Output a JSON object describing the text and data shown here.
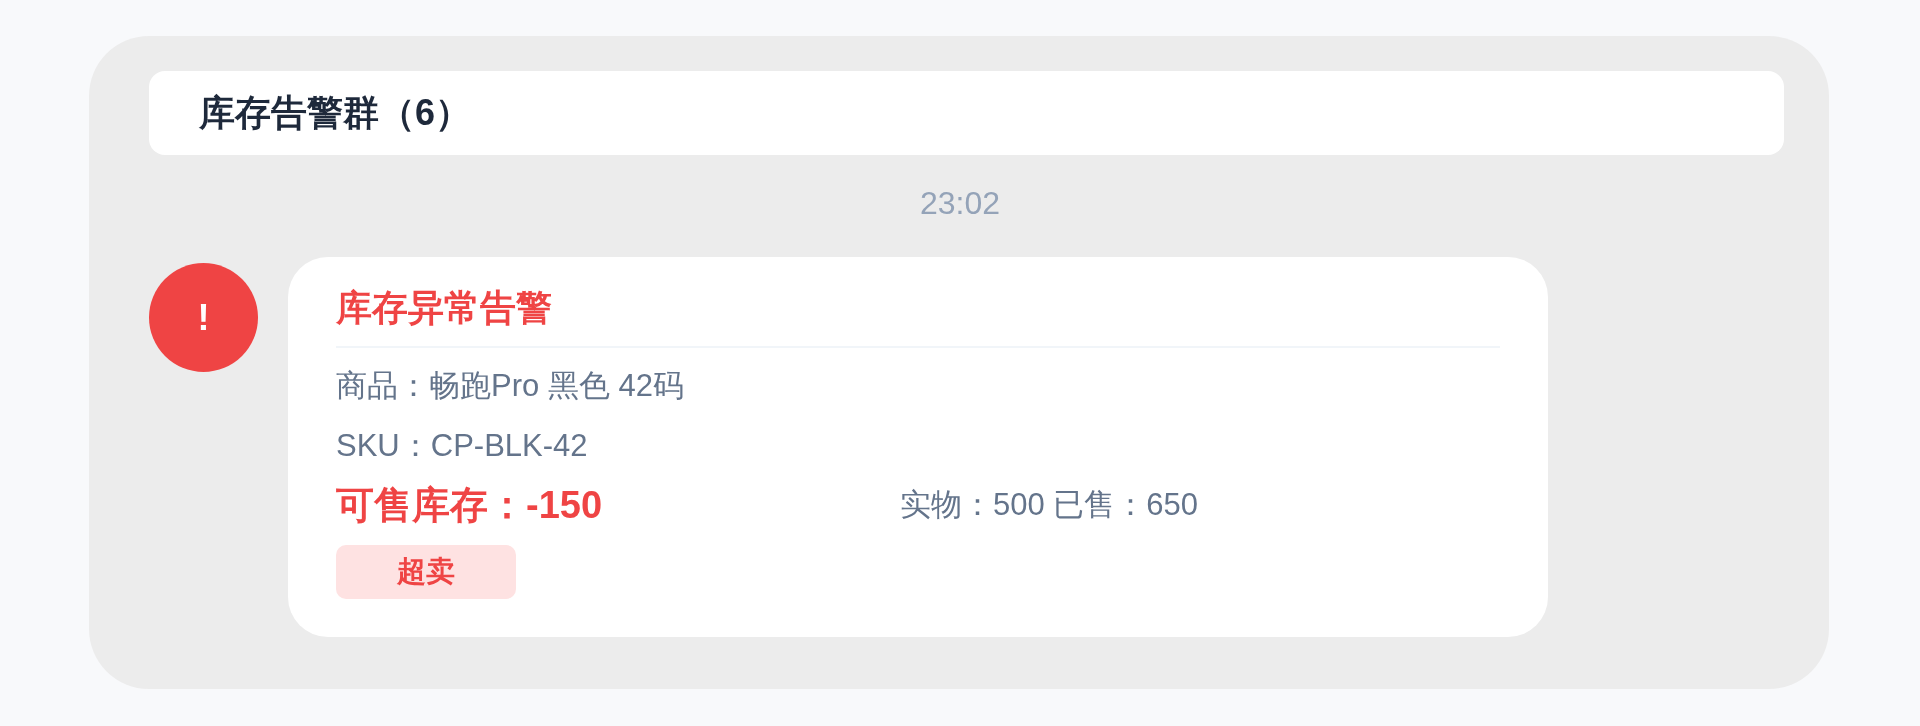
{
  "header": {
    "title": "库存告警群（6）"
  },
  "timestamp": "23:02",
  "message": {
    "avatar_symbol": "!",
    "card": {
      "title": "库存异常告警",
      "lines": [
        "商品：畅跑Pro 黑色 42码",
        "SKU：CP-BLK-42"
      ],
      "stock": {
        "label": "可售库存：-150",
        "detail": "实物：500 已售：650"
      },
      "tag": "超卖"
    }
  }
}
